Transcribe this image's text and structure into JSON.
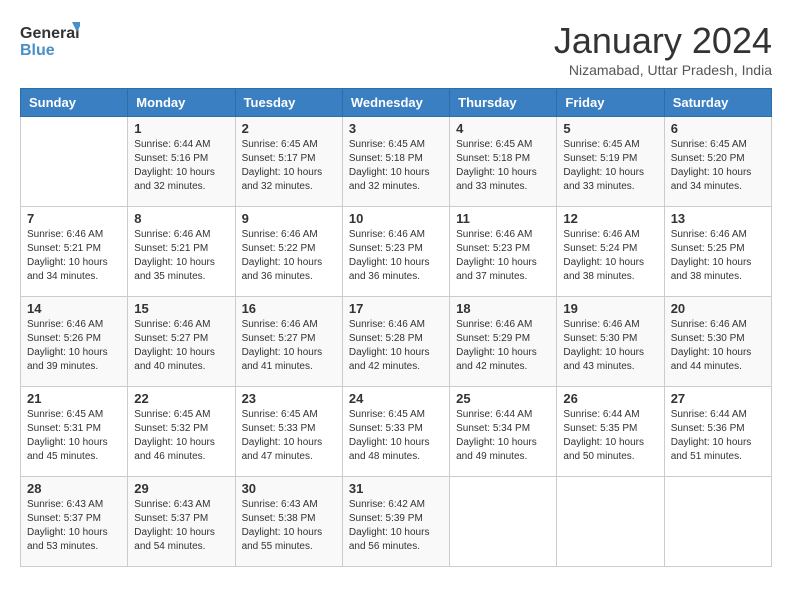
{
  "header": {
    "logo_line1": "General",
    "logo_line2": "Blue",
    "month": "January 2024",
    "location": "Nizamabad, Uttar Pradesh, India"
  },
  "days_of_week": [
    "Sunday",
    "Monday",
    "Tuesday",
    "Wednesday",
    "Thursday",
    "Friday",
    "Saturday"
  ],
  "weeks": [
    [
      {
        "num": "",
        "sunrise": "",
        "sunset": "",
        "daylight": ""
      },
      {
        "num": "1",
        "sunrise": "Sunrise: 6:44 AM",
        "sunset": "Sunset: 5:16 PM",
        "daylight": "Daylight: 10 hours and 32 minutes."
      },
      {
        "num": "2",
        "sunrise": "Sunrise: 6:45 AM",
        "sunset": "Sunset: 5:17 PM",
        "daylight": "Daylight: 10 hours and 32 minutes."
      },
      {
        "num": "3",
        "sunrise": "Sunrise: 6:45 AM",
        "sunset": "Sunset: 5:18 PM",
        "daylight": "Daylight: 10 hours and 32 minutes."
      },
      {
        "num": "4",
        "sunrise": "Sunrise: 6:45 AM",
        "sunset": "Sunset: 5:18 PM",
        "daylight": "Daylight: 10 hours and 33 minutes."
      },
      {
        "num": "5",
        "sunrise": "Sunrise: 6:45 AM",
        "sunset": "Sunset: 5:19 PM",
        "daylight": "Daylight: 10 hours and 33 minutes."
      },
      {
        "num": "6",
        "sunrise": "Sunrise: 6:45 AM",
        "sunset": "Sunset: 5:20 PM",
        "daylight": "Daylight: 10 hours and 34 minutes."
      }
    ],
    [
      {
        "num": "7",
        "sunrise": "Sunrise: 6:46 AM",
        "sunset": "Sunset: 5:21 PM",
        "daylight": "Daylight: 10 hours and 34 minutes."
      },
      {
        "num": "8",
        "sunrise": "Sunrise: 6:46 AM",
        "sunset": "Sunset: 5:21 PM",
        "daylight": "Daylight: 10 hours and 35 minutes."
      },
      {
        "num": "9",
        "sunrise": "Sunrise: 6:46 AM",
        "sunset": "Sunset: 5:22 PM",
        "daylight": "Daylight: 10 hours and 36 minutes."
      },
      {
        "num": "10",
        "sunrise": "Sunrise: 6:46 AM",
        "sunset": "Sunset: 5:23 PM",
        "daylight": "Daylight: 10 hours and 36 minutes."
      },
      {
        "num": "11",
        "sunrise": "Sunrise: 6:46 AM",
        "sunset": "Sunset: 5:23 PM",
        "daylight": "Daylight: 10 hours and 37 minutes."
      },
      {
        "num": "12",
        "sunrise": "Sunrise: 6:46 AM",
        "sunset": "Sunset: 5:24 PM",
        "daylight": "Daylight: 10 hours and 38 minutes."
      },
      {
        "num": "13",
        "sunrise": "Sunrise: 6:46 AM",
        "sunset": "Sunset: 5:25 PM",
        "daylight": "Daylight: 10 hours and 38 minutes."
      }
    ],
    [
      {
        "num": "14",
        "sunrise": "Sunrise: 6:46 AM",
        "sunset": "Sunset: 5:26 PM",
        "daylight": "Daylight: 10 hours and 39 minutes."
      },
      {
        "num": "15",
        "sunrise": "Sunrise: 6:46 AM",
        "sunset": "Sunset: 5:27 PM",
        "daylight": "Daylight: 10 hours and 40 minutes."
      },
      {
        "num": "16",
        "sunrise": "Sunrise: 6:46 AM",
        "sunset": "Sunset: 5:27 PM",
        "daylight": "Daylight: 10 hours and 41 minutes."
      },
      {
        "num": "17",
        "sunrise": "Sunrise: 6:46 AM",
        "sunset": "Sunset: 5:28 PM",
        "daylight": "Daylight: 10 hours and 42 minutes."
      },
      {
        "num": "18",
        "sunrise": "Sunrise: 6:46 AM",
        "sunset": "Sunset: 5:29 PM",
        "daylight": "Daylight: 10 hours and 42 minutes."
      },
      {
        "num": "19",
        "sunrise": "Sunrise: 6:46 AM",
        "sunset": "Sunset: 5:30 PM",
        "daylight": "Daylight: 10 hours and 43 minutes."
      },
      {
        "num": "20",
        "sunrise": "Sunrise: 6:46 AM",
        "sunset": "Sunset: 5:30 PM",
        "daylight": "Daylight: 10 hours and 44 minutes."
      }
    ],
    [
      {
        "num": "21",
        "sunrise": "Sunrise: 6:45 AM",
        "sunset": "Sunset: 5:31 PM",
        "daylight": "Daylight: 10 hours and 45 minutes."
      },
      {
        "num": "22",
        "sunrise": "Sunrise: 6:45 AM",
        "sunset": "Sunset: 5:32 PM",
        "daylight": "Daylight: 10 hours and 46 minutes."
      },
      {
        "num": "23",
        "sunrise": "Sunrise: 6:45 AM",
        "sunset": "Sunset: 5:33 PM",
        "daylight": "Daylight: 10 hours and 47 minutes."
      },
      {
        "num": "24",
        "sunrise": "Sunrise: 6:45 AM",
        "sunset": "Sunset: 5:33 PM",
        "daylight": "Daylight: 10 hours and 48 minutes."
      },
      {
        "num": "25",
        "sunrise": "Sunrise: 6:44 AM",
        "sunset": "Sunset: 5:34 PM",
        "daylight": "Daylight: 10 hours and 49 minutes."
      },
      {
        "num": "26",
        "sunrise": "Sunrise: 6:44 AM",
        "sunset": "Sunset: 5:35 PM",
        "daylight": "Daylight: 10 hours and 50 minutes."
      },
      {
        "num": "27",
        "sunrise": "Sunrise: 6:44 AM",
        "sunset": "Sunset: 5:36 PM",
        "daylight": "Daylight: 10 hours and 51 minutes."
      }
    ],
    [
      {
        "num": "28",
        "sunrise": "Sunrise: 6:43 AM",
        "sunset": "Sunset: 5:37 PM",
        "daylight": "Daylight: 10 hours and 53 minutes."
      },
      {
        "num": "29",
        "sunrise": "Sunrise: 6:43 AM",
        "sunset": "Sunset: 5:37 PM",
        "daylight": "Daylight: 10 hours and 54 minutes."
      },
      {
        "num": "30",
        "sunrise": "Sunrise: 6:43 AM",
        "sunset": "Sunset: 5:38 PM",
        "daylight": "Daylight: 10 hours and 55 minutes."
      },
      {
        "num": "31",
        "sunrise": "Sunrise: 6:42 AM",
        "sunset": "Sunset: 5:39 PM",
        "daylight": "Daylight: 10 hours and 56 minutes."
      },
      {
        "num": "",
        "sunrise": "",
        "sunset": "",
        "daylight": ""
      },
      {
        "num": "",
        "sunrise": "",
        "sunset": "",
        "daylight": ""
      },
      {
        "num": "",
        "sunrise": "",
        "sunset": "",
        "daylight": ""
      }
    ]
  ]
}
